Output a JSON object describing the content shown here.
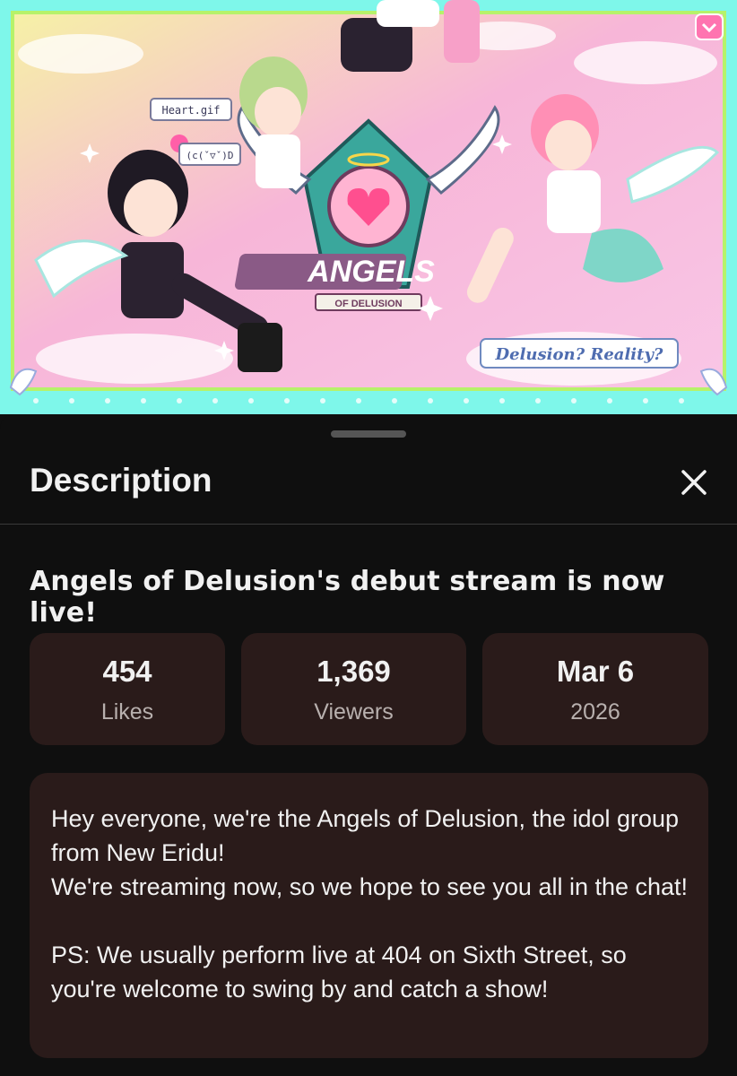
{
  "banner": {
    "logo_main": "ANGELS",
    "logo_sub": "OF DELUSION",
    "sticker_heart": "Heart.gif",
    "sticker_face": "(c(ˇ▽ˇ)D",
    "tagline": "Delusion? Reality?"
  },
  "sheet": {
    "title": "Description",
    "close_label": "×"
  },
  "headline": "Angels of Delusion's debut stream is now live!",
  "stats": [
    {
      "value": "454",
      "label": "Likes"
    },
    {
      "value": "1,369",
      "label": "Viewers"
    },
    {
      "value": "Mar 6",
      "label": "2026"
    }
  ],
  "description": "Hey everyone, we're the Angels of Delusion, the idol group from New Eridu!\nWe're streaming now, so we hope to see you all in the chat!\n\nPS: We usually perform live at 404 on Sixth Street, so you're welcome to swing by and catch a show!",
  "colors": {
    "sheet_bg": "#0f0f0f",
    "card_bg": "#2a1b1a",
    "banner_frame": "#7ef7ea",
    "banner_pink": "#f7b6d8",
    "banner_yellow": "#f6f1a6"
  }
}
